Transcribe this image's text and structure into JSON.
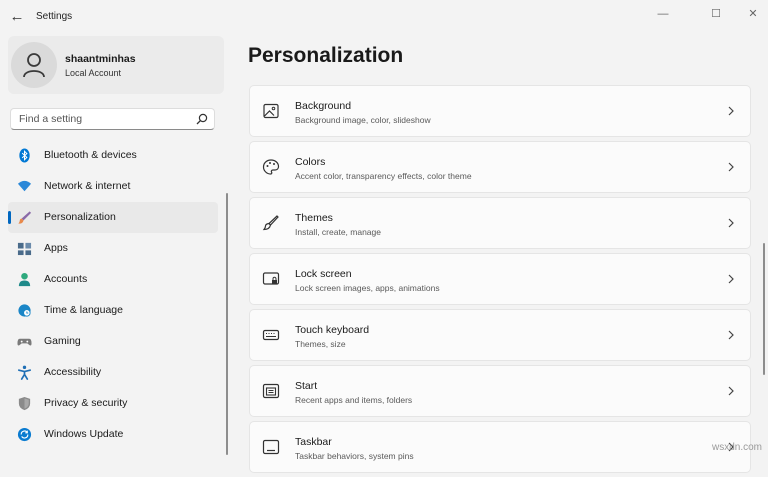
{
  "window": {
    "title": "Settings",
    "back_glyph": "←",
    "minimize_glyph": "—",
    "maximize_glyph": "☐",
    "close_glyph": "✕"
  },
  "profile": {
    "name": "shaantminhas",
    "account_type": "Local Account"
  },
  "search": {
    "placeholder": "Find a setting"
  },
  "sidebar": {
    "items": [
      {
        "label": "Bluetooth & devices",
        "icon": "bluetooth-icon",
        "color": "#0078d4"
      },
      {
        "label": "Network & internet",
        "icon": "wifi-icon",
        "color": "#2b88d8"
      },
      {
        "label": "Personalization",
        "icon": "brush-icon",
        "color": "#e8894b",
        "active": true
      },
      {
        "label": "Apps",
        "icon": "apps-icon",
        "color": "#4a6b8a"
      },
      {
        "label": "Accounts",
        "icon": "person-icon",
        "color": "#2ea97d"
      },
      {
        "label": "Time & language",
        "icon": "globe-clock-icon",
        "color": "#1a86c7"
      },
      {
        "label": "Gaming",
        "icon": "controller-icon",
        "color": "#7a7a7a"
      },
      {
        "label": "Accessibility",
        "icon": "accessibility-icon",
        "color": "#1f6fb5"
      },
      {
        "label": "Privacy & security",
        "icon": "shield-icon",
        "color": "#8a8a8a"
      },
      {
        "label": "Windows Update",
        "icon": "update-icon",
        "color": "#0a7bd0"
      }
    ]
  },
  "main": {
    "title": "Personalization",
    "cards": [
      {
        "title": "Background",
        "subtitle": "Background image, color, slideshow",
        "icon": "image-icon"
      },
      {
        "title": "Colors",
        "subtitle": "Accent color, transparency effects, color theme",
        "icon": "palette-icon"
      },
      {
        "title": "Themes",
        "subtitle": "Install, create, manage",
        "icon": "brush-icon"
      },
      {
        "title": "Lock screen",
        "subtitle": "Lock screen images, apps, animations",
        "icon": "lock-screen-icon"
      },
      {
        "title": "Touch keyboard",
        "subtitle": "Themes, size",
        "icon": "keyboard-icon"
      },
      {
        "title": "Start",
        "subtitle": "Recent apps and items, folders",
        "icon": "start-icon"
      },
      {
        "title": "Taskbar",
        "subtitle": "Taskbar behaviors, system pins",
        "icon": "taskbar-icon"
      }
    ]
  },
  "watermark": "wsxdn.com",
  "colors": {
    "accent": "#0067c0",
    "background": "#f3f3f3",
    "card": "#fbfbfb"
  }
}
